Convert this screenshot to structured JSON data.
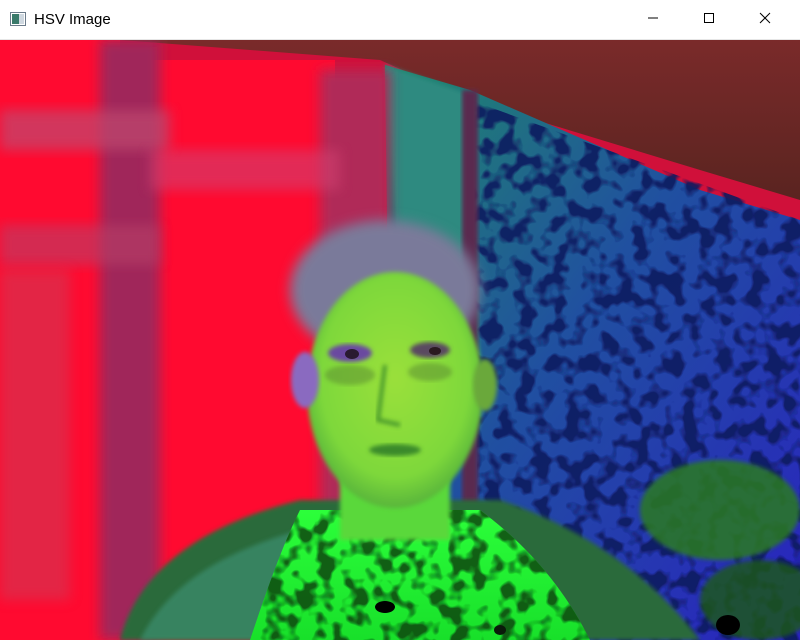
{
  "window": {
    "title": "HSV Image",
    "app_icon": "opencv-window-icon",
    "controls": {
      "minimize_icon": "minimize-icon",
      "maximize_icon": "maximize-icon",
      "close_icon": "close-icon"
    }
  },
  "canvas": {
    "content": "hsv-webcam-frame",
    "colors": {
      "red_panel": "#ff1032",
      "magenta_frame": "#b0386a",
      "teal_wall": "#2f8a7a",
      "blue_wall": "#2a33b8",
      "skin_green": "#8ee03a",
      "shirt_green": "#22ff34",
      "ceiling_brown": "#6a2a24"
    }
  }
}
